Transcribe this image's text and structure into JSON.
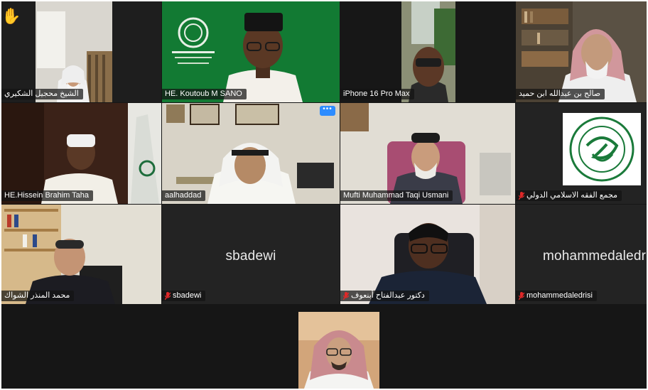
{
  "participants": [
    {
      "name": "الشيخ محجيل الشكيري",
      "camera_on": true,
      "muted": false,
      "raised_hand": true
    },
    {
      "name": "HE. Koutoub M SANO",
      "camera_on": true,
      "muted": false,
      "active_speaker": true
    },
    {
      "name": "iPhone 16 Pro Max",
      "camera_on": true,
      "muted": false
    },
    {
      "name": "صالح بن عبدالله ابن حميد",
      "camera_on": true,
      "muted": false
    },
    {
      "name": "HE.Hissein Brahim Taha",
      "camera_on": true,
      "muted": false
    },
    {
      "name": "aalhaddad",
      "camera_on": true,
      "muted": false
    },
    {
      "name": "Mufti Muhammad Taqi Usmani",
      "camera_on": true,
      "muted": false
    },
    {
      "name": "مجمع الفقه الاسلامي الدولي",
      "camera_on": true,
      "muted": true
    },
    {
      "name": "محمد المنذر الشواك",
      "camera_on": true,
      "muted": false
    },
    {
      "name": "sbadewi",
      "big_label": "sbadewi",
      "camera_on": false,
      "muted": true
    },
    {
      "name": "دكتور عبدالفتاح أبنعوف",
      "camera_on": true,
      "muted": true
    },
    {
      "name": "mohammedaledrisi",
      "big_label": "mohammedaledri",
      "camera_on": false,
      "muted": true
    },
    {
      "name": "",
      "camera_on": true,
      "muted": false
    }
  ],
  "colors": {
    "active_speaker_border": "#5ab03c",
    "muted_icon": "#e02828",
    "tile_bg": "#232323",
    "options_button": "#2d8cff"
  },
  "icons": {
    "raised_hand": "raised-hand-icon",
    "muted": "microphone-muted-icon",
    "options": "more-options-icon"
  },
  "ui": {
    "options_button_label": "•••",
    "raised_hand_glyph": "✋"
  }
}
